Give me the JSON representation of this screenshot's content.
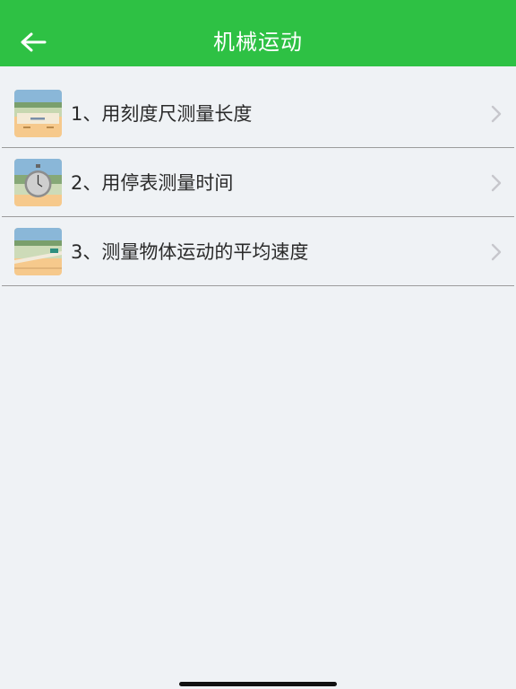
{
  "header": {
    "title": "机械运动",
    "back_icon": "arrow-left-icon",
    "background_color": "#2ec144"
  },
  "list": {
    "items": [
      {
        "label": "1、用刻度尺测量长度",
        "thumbnail": "ruler-scene-thumbnail",
        "chevron_icon": "chevron-right-icon"
      },
      {
        "label": "2、用停表测量时间",
        "thumbnail": "stopwatch-scene-thumbnail",
        "chevron_icon": "chevron-right-icon"
      },
      {
        "label": "3、测量物体运动的平均速度",
        "thumbnail": "car-track-scene-thumbnail",
        "chevron_icon": "chevron-right-icon"
      }
    ]
  },
  "colors": {
    "background": "#eff2f5",
    "divider": "#9c9c9c",
    "text": "#2a2a2a",
    "chevron": "#c7c7cc"
  }
}
